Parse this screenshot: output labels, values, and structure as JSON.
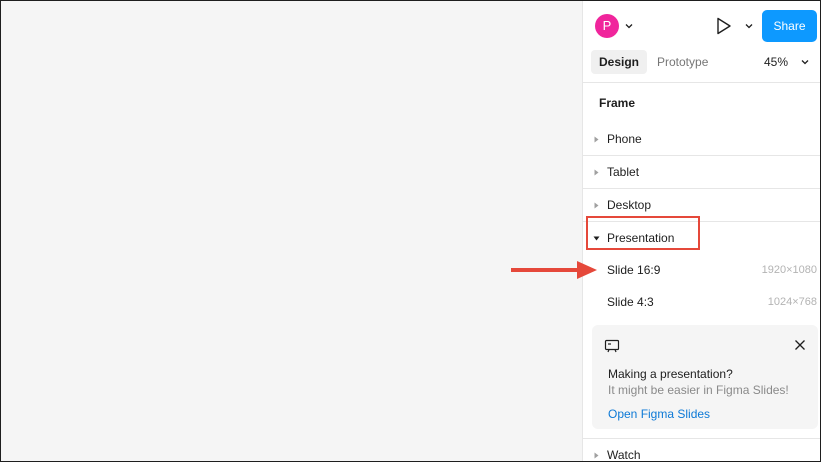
{
  "header": {
    "avatar_initial": "P",
    "share_label": "Share"
  },
  "tabs": {
    "design": "Design",
    "prototype": "Prototype",
    "zoom": "45%"
  },
  "frame_section": {
    "title": "Frame",
    "items": [
      {
        "label": "Phone",
        "expanded": false
      },
      {
        "label": "Tablet",
        "expanded": false
      },
      {
        "label": "Desktop",
        "expanded": false
      },
      {
        "label": "Presentation",
        "expanded": true
      },
      {
        "label": "Slide 16:9",
        "size": "1920×1080"
      },
      {
        "label": "Slide 4:3",
        "size": "1024×768"
      },
      {
        "label": "Watch",
        "expanded": false
      }
    ]
  },
  "callout": {
    "title": "Making a presentation?",
    "subtitle": "It might be easier in Figma Slides!",
    "link": "Open Figma Slides"
  },
  "colors": {
    "accent": "#0d99ff",
    "avatar": "#f0259c",
    "annotation": "#e5483a",
    "link": "#0d79d6"
  },
  "icons": [
    "chevron-down-icon",
    "play-icon",
    "caret-right-icon",
    "caret-down-icon",
    "presentation-icon",
    "close-icon",
    "annotation-arrow"
  ]
}
